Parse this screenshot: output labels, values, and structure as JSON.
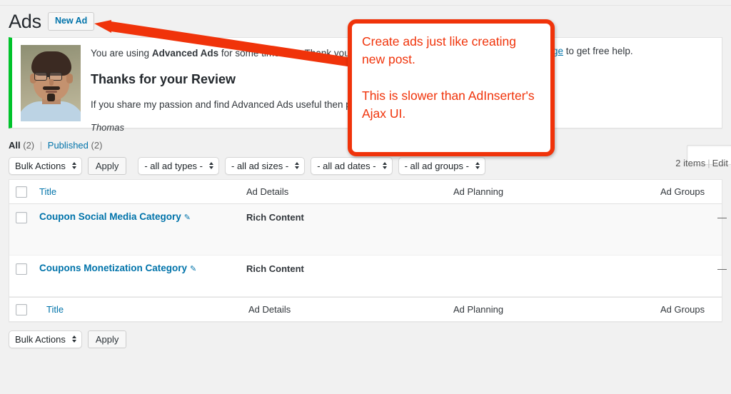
{
  "header": {
    "page_title": "Ads",
    "new_ad_button": "New Ad"
  },
  "notice": {
    "line1_prefix": "You are using ",
    "line1_bold": "Advanced Ads",
    "line1_suffix": " for some time now. Thank you. If",
    "line1_tail_link": "ge",
    "line1_tail": " to get free help.",
    "heading": "Thanks for your Review",
    "line2": "If you share my passion and find Advanced Ads useful then plea",
    "signature": "Thomas",
    "accent_color": "#00c32b",
    "avatar_name": "thomas-avatar"
  },
  "views": {
    "all_label": "All",
    "all_count": "(2)",
    "separator": "|",
    "published_label": "Published",
    "published_count": "(2)"
  },
  "search": {
    "value": "",
    "placeholder": ""
  },
  "tablenav_top": {
    "bulk_actions": "Bulk Actions",
    "apply": "Apply",
    "filter_ad_types": "- all ad types -",
    "filter_ad_sizes": "- all ad sizes -",
    "filter_ad_dates": "- all ad dates -",
    "filter_ad_groups": "- all ad groups -",
    "items_count": "2 items",
    "divider": "|",
    "edit_label": "Edit"
  },
  "tablenav_bottom": {
    "bulk_actions": "Bulk Actions",
    "apply": "Apply"
  },
  "table": {
    "columns": [
      {
        "label": "Title",
        "is_link": true
      },
      {
        "label": "Ad Details",
        "is_link": false
      },
      {
        "label": "Ad Planning",
        "is_link": false
      },
      {
        "label": "Ad Groups",
        "is_link": false
      }
    ],
    "rows": [
      {
        "title": "Coupon Social Media Category",
        "edit_icon": "pencil-icon",
        "ad_details": "Rich Content",
        "ad_planning": "",
        "ad_groups": "—"
      },
      {
        "title": "Coupons Monetization Category",
        "edit_icon": "pencil-icon",
        "ad_details": "Rich Content",
        "ad_planning": "",
        "ad_groups": "—"
      }
    ]
  },
  "annotation": {
    "line_a": "Create ads just like creating new post.",
    "line_b": "This is slower than AdInserter's Ajax UI.",
    "color": "#f0330a"
  },
  "colors": {
    "link": "#0073aa",
    "page_bg": "#f1f1f1",
    "notice_accent": "#00c32b",
    "annotation_red": "#f0330a"
  }
}
